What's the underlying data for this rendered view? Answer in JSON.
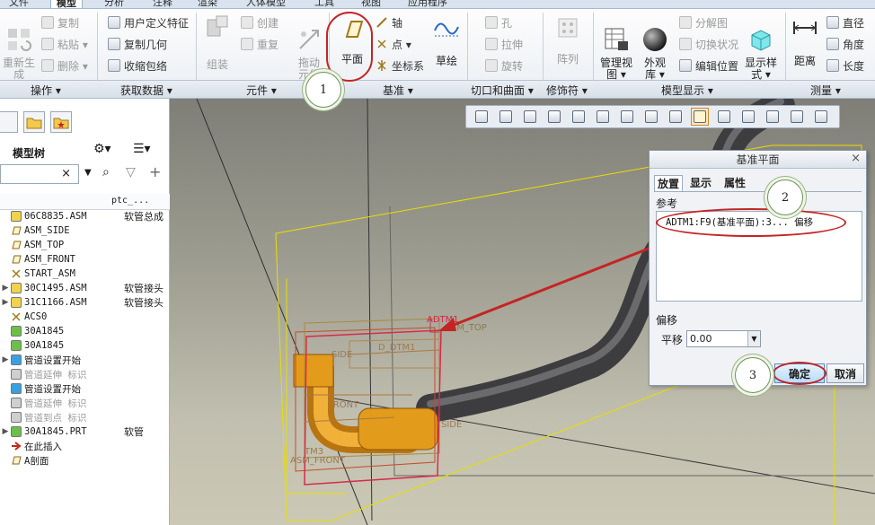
{
  "tabs": [
    "文件",
    "模型",
    "分析",
    "注释",
    "渲染",
    "人体模型",
    "工具",
    "视图",
    "应用程序"
  ],
  "ribbon": {
    "groups": [
      {
        "label": "操作 ▾"
      },
      {
        "label": "获取数据 ▾"
      },
      {
        "label": "元件 ▾"
      },
      {
        "label": "基准 ▾"
      },
      {
        "label": "切口和曲面 ▾"
      },
      {
        "label": "修饰符 ▾"
      },
      {
        "label": "模型显示 ▾"
      },
      {
        "label": "测量 ▾"
      }
    ],
    "regenerate": "重新生\n成",
    "copy": "复制",
    "paste": "粘贴 ▾",
    "delete": "删除 ▾",
    "user_feature": "用户定义特征",
    "copy_geometry": "复制几何",
    "shrinkwrap": "收缩包络",
    "assemble": "组装",
    "create": "创建",
    "repeat": "重复",
    "drag": "拖动\n元件",
    "plane": "平面",
    "axis": "轴",
    "point": "点 ▾",
    "csys": "坐标系",
    "sketch": "草绘",
    "hole": "孔",
    "extrude": "拉伸",
    "revolve": "旋转",
    "pattern": "阵列",
    "manage_views": "管理视\n图 ▾",
    "appearance": "外观\n库 ▾",
    "explode": "分解图",
    "toggle_status": "切换状况",
    "edit_position": "编辑位置",
    "display_style": "显示样\n式 ▾",
    "distance": "距离",
    "diameter": "直径",
    "angle": "角度",
    "length": "长度"
  },
  "model_tree": {
    "title": "模型树",
    "column": "ptc_...",
    "rows": [
      {
        "name": "06C8835.ASM",
        "col": "软管总成",
        "exp": "",
        "grey": false,
        "icon": "assembly-icon"
      },
      {
        "name": "ASM_SIDE",
        "col": "",
        "exp": "",
        "grey": false,
        "icon": "datum-plane-icon"
      },
      {
        "name": "ASM_TOP",
        "col": "",
        "exp": "",
        "grey": false,
        "icon": "datum-plane-icon"
      },
      {
        "name": "ASM_FRONT",
        "col": "",
        "exp": "",
        "grey": false,
        "icon": "datum-plane-icon"
      },
      {
        "name": "START_ASM",
        "col": "",
        "exp": "",
        "grey": false,
        "icon": "csys-icon"
      },
      {
        "name": "30C1495.ASM",
        "col": "软管接头",
        "exp": "▶",
        "grey": false,
        "icon": "assembly-icon"
      },
      {
        "name": "31C1166.ASM",
        "col": "软管接头",
        "exp": "▶",
        "grey": false,
        "icon": "assembly-icon"
      },
      {
        "name": "ACS0",
        "col": "",
        "exp": "",
        "grey": false,
        "icon": "csys-icon"
      },
      {
        "name": "30A1845",
        "col": "",
        "exp": "",
        "grey": false,
        "icon": "pipe-icon"
      },
      {
        "name": "30A1845",
        "col": "",
        "exp": "",
        "grey": false,
        "icon": "pipe-icon"
      },
      {
        "name": "管道设置开始",
        "col": "",
        "exp": "▶",
        "grey": false,
        "icon": "pipe-start-icon"
      },
      {
        "name": "管道延伸 标识",
        "col": "",
        "exp": "",
        "grey": true,
        "icon": "pipe-extend-icon"
      },
      {
        "name": "管道设置开始",
        "col": "",
        "exp": "",
        "grey": false,
        "icon": "pipe-start-icon"
      },
      {
        "name": "管道延伸 标识",
        "col": "",
        "exp": "",
        "grey": true,
        "icon": "pipe-extend-icon"
      },
      {
        "name": "管道到点 标识",
        "col": "",
        "exp": "",
        "grey": true,
        "icon": "pipe-extend-icon"
      },
      {
        "name": "30A1845.PRT",
        "col": "软管",
        "exp": "▶",
        "grey": false,
        "icon": "part-icon"
      },
      {
        "name": "在此插入",
        "col": "",
        "exp": "",
        "grey": false,
        "icon": "insert-arrow-icon"
      },
      {
        "name": "A剖面",
        "col": "",
        "exp": "",
        "grey": false,
        "icon": "section-icon"
      }
    ]
  },
  "viewport": {
    "labels": {
      "adtm1": "ADTM1",
      "asm_top": "ASM_TOP",
      "d_dtm1": "D_DTM1",
      "side1": "SIDE",
      "front1": "FRONT",
      "side2": "SIDE",
      "tm3": "TM3",
      "asm_front": "ASM_FRONT"
    }
  },
  "dialog": {
    "title": "基准平面",
    "close": "×",
    "tabs": [
      "放置",
      "显示",
      "属性"
    ],
    "references_label": "参考",
    "reference_item": "ADTM1:F9(基准平面):3... 偏移",
    "offset_label": "偏移",
    "translation_label": "平移",
    "translation_value": "0.00",
    "ok": "确定",
    "cancel": "取消"
  },
  "callouts": [
    "1",
    "2",
    "3"
  ],
  "colors": {
    "annotation_red": "#c42424",
    "datum_yellow": "#e8df00",
    "pipe_orange": "#e39b1c",
    "hose_grey": "#5a5a5c"
  }
}
